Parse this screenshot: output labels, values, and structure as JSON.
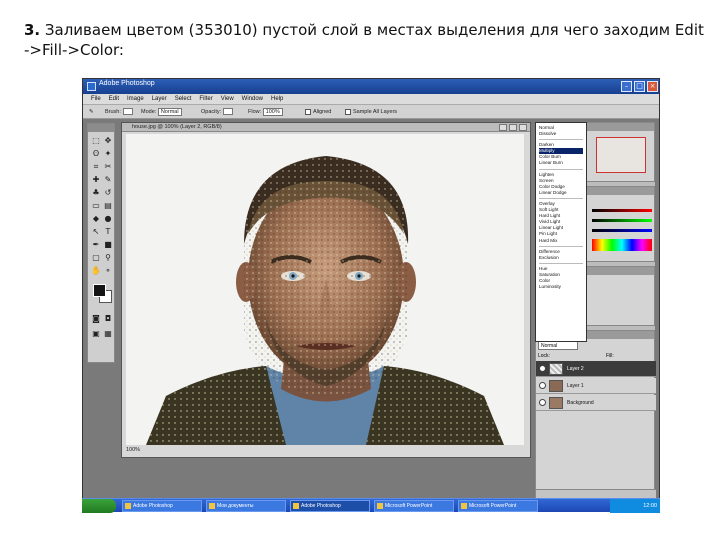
{
  "caption": {
    "number": "3.",
    "text_line1": " Заливаем цветом (353010) пустой слой в местах выделения для чего заходим Edit",
    "text_line2": "->Fill->Color:"
  },
  "window": {
    "title": "Adobe Photoshop"
  },
  "menu": [
    "File",
    "Edit",
    "Image",
    "Layer",
    "Select",
    "Filter",
    "View",
    "Window",
    "Help"
  ],
  "options_bar": {
    "opacity_label": "Opacity:",
    "mode_label": "Mode:",
    "mode_value": "Normal",
    "flow_label": "Flow:",
    "flow_value": "100%",
    "aligned_label": "Aligned",
    "sample_all_label": "Sample All Layers"
  },
  "document": {
    "title": "house.jpg @ 100% (Layer 2, RGB/8)",
    "status": "100%"
  },
  "blend_modes": {
    "groups": [
      [
        "Normal",
        "Dissolve"
      ],
      [
        "Darken",
        "Multiply",
        "Color Burn",
        "Linear Burn"
      ],
      [
        "Lighten",
        "Screen",
        "Color Dodge",
        "Linear Dodge"
      ],
      [
        "Overlay",
        "Soft Light",
        "Hard Light",
        "Vivid Light",
        "Linear Light",
        "Pin Light",
        "Hard Mix"
      ],
      [
        "Difference",
        "Exclusion"
      ],
      [
        "Hue",
        "Saturation",
        "Color",
        "Luminosity"
      ]
    ],
    "highlighted": "Multiply",
    "current_value": "Normal"
  },
  "layers": [
    {
      "name": "Layer 2",
      "active": true
    },
    {
      "name": "Layer 1",
      "active": false
    },
    {
      "name": "Background",
      "active": false
    }
  ],
  "layers_panel": {
    "lock_label": "Lock:",
    "fill_label": "Fill:"
  },
  "taskbar": {
    "buttons": [
      "Adobe Photoshop",
      "Мои документы",
      "Adobe Photoshop",
      "Microsoft PowerPoint",
      "Microsoft PowerPoint"
    ],
    "clock": "12:00"
  },
  "colors": {
    "fill_color": "#353010",
    "title_bar": "#2d5fb8",
    "highlight": "#0a246a"
  }
}
